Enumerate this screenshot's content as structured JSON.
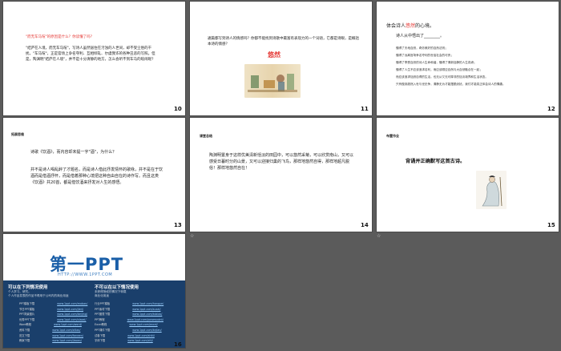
{
  "slides": {
    "s10": {
      "number": "10",
      "question": "\"而无车马喧\"的原因是什么？你读懂了吗？",
      "body": "\"结庐在人境，而无车马喧\"，写诗人虽然居住在污浊的人世间，却不受尘俗的干扰，\"车马喧\"，正是官场上争名夺利、互相倾轧、尔虞我诈的各种丑恶的写照。但是，陶渊明\"结庐在人境\"，并不是十分清静的地方，怎么会听不到车马的喧闹呢？"
    },
    "s11": {
      "number": "11",
      "question": "通篇都写到诗人的情感吗？你都不能找到诗歌中最富有表现力的一个词语，它都是诗眼，是概括本诗的情感？",
      "answer": "悠然"
    },
    "s12": {
      "number": "12",
      "heading": "体会诗人悠然的心境。",
      "heading_highlight": "悠然",
      "prompt": "诗人从中悟出了________。",
      "lines": [
        "懂得了天地自然，奇妙美好的自然法则；",
        "懂得了远离官场争名夺利的世俗社会的可贵；",
        "懂得了享受自然的诗人生命和谐，懂得了清新恬静的人生真谛；",
        "懂得了人生不应该追求名利，而应该顺应自然与大自然融合在一起；",
        "而应该追求恬然自得的生活，也无从又无可厚非的恬淡境界和生活状态。",
        "只有做到超然入世与世无争，清静无为才能摆脱纷扰，我们才能真正体会诗人的情趣。"
      ]
    },
    "s13": {
      "number": "13",
      "label": "拓展思维",
      "q": "诗歌《饮酒》，而内容却未提一字\"酒\"，为什么？",
      "a": "并不是诗人喝乱醉了才题名，而是诗人借此抒发情怀的歌咏，并不是在于饮酒而是借酒抒怀，而是借着那种心境把这种自由自在的诗作写。而且这类《饮酒》共20首，都是借饮酒来抒发对人生的感悟。"
    },
    "s14": {
      "number": "14",
      "label": "课堂总结",
      "body": "陶渊明置身于这样优美清新恬淡的田园中，可以悠然采菊，可以欣赏南山，又可以感受日暮时分的山景，又可以迎接归巢的飞鸟，那样地悠然自得，那样地超凡脱俗！那样地悠然自在！"
    },
    "s15": {
      "number": "15",
      "label": "布置作业",
      "task": "背诵并正确默写这首古诗。"
    },
    "s16": {
      "number": "16",
      "logo": "第一PPT",
      "url": "HTTP://WWW.1PPT.COM",
      "can_title": "可以在下列情况使用",
      "can_items": [
        "个人学习、研究。",
        "个人作品发表的作品不得用于公司内的商业用途"
      ],
      "cannot_title": "不可以在以下情况使用",
      "cannot_items": [
        "未获得授权的情况下转载",
        "商业化用途"
      ],
      "left_links": [
        {
          "label": "PPT模板下载",
          "url": "www.1ppt.com/moban/"
        },
        {
          "label": "节日PPT模板",
          "url": "www.1ppt.com/jieri/"
        },
        {
          "label": "PPT背景图片",
          "url": "www.1ppt.com/beijing/"
        },
        {
          "label": "优秀PPT下载",
          "url": "www.1ppt.com/xiazai/"
        },
        {
          "label": "Word教程",
          "url": "www.1ppt.com/word/"
        },
        {
          "label": "资料下载",
          "url": "www.1ppt.com/ziliao/"
        },
        {
          "label": "范文下载",
          "url": "www.1ppt.com/fanwen/"
        },
        {
          "label": "教案下载",
          "url": "www.1ppt.com/jiaoan/"
        }
      ],
      "right_links": [
        {
          "label": "行业PPT模板",
          "url": "www.1ppt.com/hangye/"
        },
        {
          "label": "PPT素材下载",
          "url": "www.1ppt.com/sucai/"
        },
        {
          "label": "PPT图表下载",
          "url": "www.1ppt.com/tubiao/"
        },
        {
          "label": "PPT教程",
          "url": "www.1ppt.com/powerpoint/"
        },
        {
          "label": "Excel教程",
          "url": "www.1ppt.com/excel/"
        },
        {
          "label": "PPT课件下载",
          "url": "www.1ppt.com/kejian/"
        },
        {
          "label": "试卷下载",
          "url": "www.1ppt.com/shiti/"
        },
        {
          "label": "字体下载",
          "url": "www.1ppt.com/ziti/"
        }
      ]
    }
  },
  "colors": {
    "accent_red": "#e53935",
    "brand_blue": "#1a3f6b",
    "background": "#5b5b5b"
  }
}
